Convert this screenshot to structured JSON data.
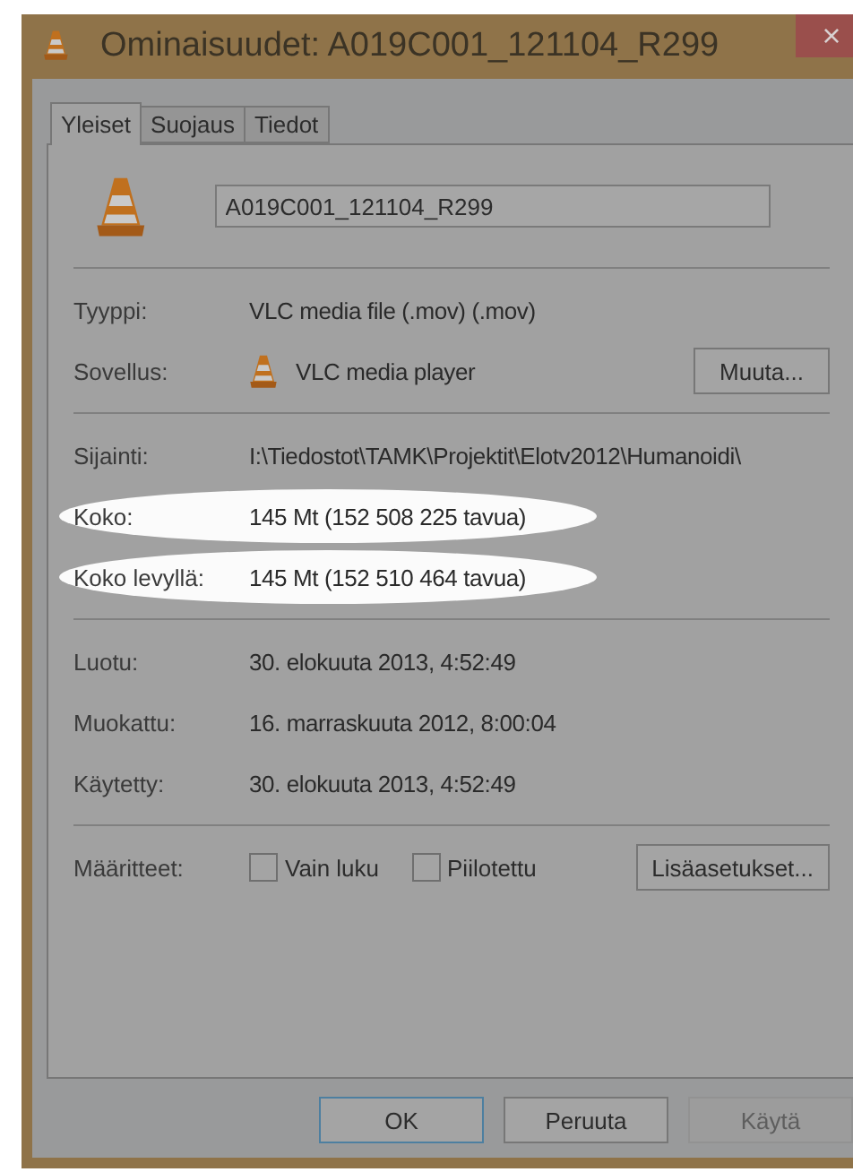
{
  "window": {
    "title": "Ominaisuudet: A019C001_121104_R299",
    "close": "×"
  },
  "tabs": [
    {
      "label": "Yleiset",
      "selected": true
    },
    {
      "label": "Suojaus",
      "selected": false
    },
    {
      "label": "Tiedot",
      "selected": false
    }
  ],
  "file_name": {
    "value": "A019C001_121104_R299"
  },
  "sections": [
    [
      {
        "label": "Tyyppi:",
        "value": "VLC media file (.mov) (.mov)",
        "highlighted": false
      },
      {
        "label": "Sovellus:",
        "value": "VLC media player",
        "highlighted": false,
        "app_icon": true,
        "button": "Muuta..."
      }
    ],
    [
      {
        "label": "Sijainti:",
        "value": "I:\\Tiedostot\\TAMK\\Projektit\\Elotv2012\\Humanoidi\\",
        "highlighted": false
      },
      {
        "label": "Koko:",
        "value": "145 Mt (152 508 225 tavua)",
        "highlighted": true
      },
      {
        "label": "Koko levyllä:",
        "value": "145 Mt (152 510 464 tavua)",
        "highlighted": true
      }
    ],
    [
      {
        "label": "Luotu:",
        "value": "30. elokuuta 2013, 4:52:49",
        "highlighted": false
      },
      {
        "label": "Muokattu:",
        "value": "16. marraskuuta 2012, 8:00:04",
        "highlighted": false
      },
      {
        "label": "Käytetty:",
        "value": "30. elokuuta 2013, 4:52:49",
        "highlighted": false
      }
    ]
  ],
  "attributes": {
    "label": "Määritteet:",
    "checkboxes": [
      {
        "label": "Vain luku",
        "checked": false
      },
      {
        "label": "Piilotettu",
        "checked": false
      }
    ],
    "button": "Lisäasetukset..."
  },
  "buttons": [
    {
      "label": "OK",
      "default": true,
      "disabled": false
    },
    {
      "label": "Peruuta",
      "default": false,
      "disabled": false
    },
    {
      "label": "Käytä",
      "default": false,
      "disabled": true
    }
  ]
}
